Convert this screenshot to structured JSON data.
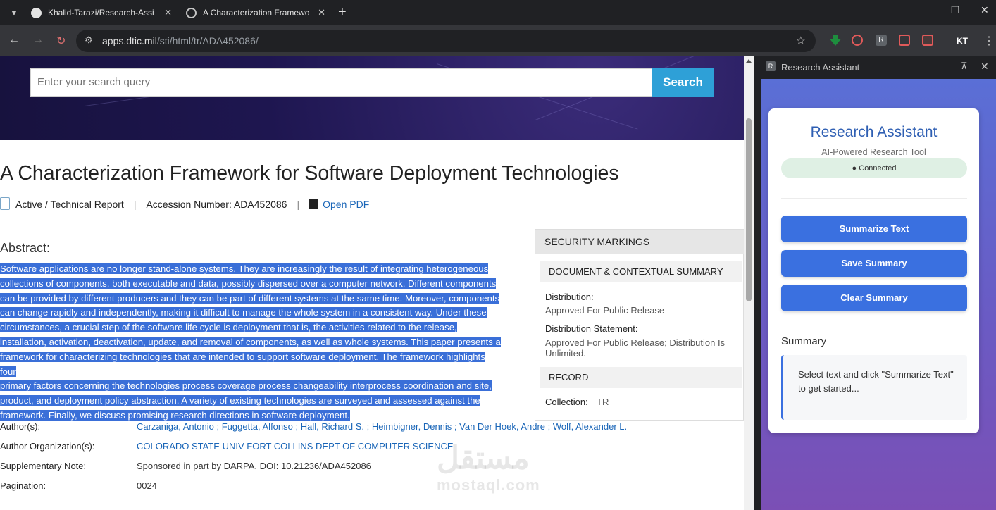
{
  "browser": {
    "tabs": [
      {
        "title": "Khalid-Tarazi/Research-Assistan",
        "active": false
      },
      {
        "title": "A Characterization Framework f",
        "active": true
      }
    ],
    "url_host": "apps.dtic.mil",
    "url_path": "/sti/html/tr/ADA452086/",
    "profile_initials": "KT"
  },
  "search": {
    "placeholder": "Enter your search query",
    "button": "Search"
  },
  "document": {
    "title": "A Characterization Framework for Software Deployment Technologies",
    "status": "Active / Technical Report",
    "accession": "Accession Number: ADA452086",
    "open_pdf": "Open PDF",
    "abstract_heading": "Abstract:",
    "abstract_lines": [
      "Software applications are no longer stand-alone systems. They are increasingly the result of integrating heterogeneous",
      "collections of components, both executable and data, possibly dispersed over a computer network. Different components",
      "can be provided by different producers and they can be part of different systems at the same time. Moreover, components",
      "can change rapidly and independently, making it difficult to manage the whole system in a consistent way. Under these",
      "circumstances, a crucial step of the software life cycle is deployment that is, the activities related to the release,",
      "installation, activation, deactivation, update, and removal of components, as well as whole systems. This paper presents a",
      "framework for characterizing technologies that are intended to support software deployment. The framework highlights four",
      "primary factors concerning the technologies process coverage process changeability interprocess coordination and site,",
      "product, and deployment policy abstraction. A variety of existing technologies are surveyed and assessed against the",
      "framework. Finally, we discuss promising research directions in software deployment."
    ],
    "details": [
      {
        "label": "Author(s):",
        "value": "Carzaniga, Antonio ; Fuggetta, Alfonso ; Hall, Richard S. ; Heimbigner, Dennis ; Van Der Hoek, Andre ; Wolf, Alexander L.",
        "link": true
      },
      {
        "label": "Author Organization(s):",
        "value": "COLORADO STATE UNIV FORT COLLINS DEPT OF COMPUTER SCIENCE",
        "link": true
      },
      {
        "label": "Supplementary Note:",
        "value": "Sponsored in part by DARPA. DOI: 10.21236/ADA452086",
        "link": false
      },
      {
        "label": "Pagination:",
        "value": "0024",
        "link": false
      }
    ]
  },
  "security": {
    "heading": "SECURITY MARKINGS",
    "summary_heading": "DOCUMENT & CONTEXTUAL SUMMARY",
    "distribution_label": "Distribution:",
    "distribution_value": "Approved For Public Release",
    "statement_label": "Distribution Statement:",
    "statement_value": "Approved For Public Release; Distribution Is Unlimited.",
    "record_heading": "RECORD",
    "collection_label": "Collection:",
    "collection_value": "TR"
  },
  "watermark": {
    "arabic": "مستقل",
    "latin": "mostaql.com"
  },
  "side_panel": {
    "header_title": "Research Assistant",
    "title": "Research Assistant",
    "subtitle": "AI-Powered Research Tool",
    "status": "● Connected",
    "buttons": [
      "Summarize Text",
      "Save Summary",
      "Clear Summary"
    ],
    "summary_heading": "Summary",
    "summary_placeholder": "Select text and click \"Summarize Text\" to get started..."
  },
  "colors": {
    "accent": "#3a70e0",
    "search_button": "#2ea0d7",
    "selection": "#3a6fd8",
    "link": "#1a66b8"
  }
}
